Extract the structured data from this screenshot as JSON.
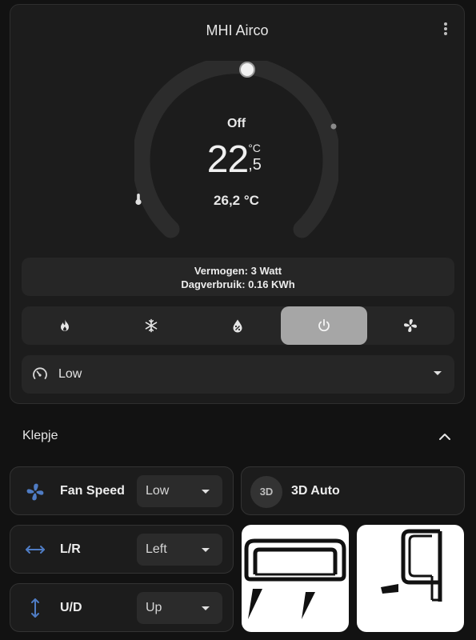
{
  "card": {
    "title": "MHI Airco",
    "state": "Off",
    "target_temp_int": "22",
    "target_temp_dec": ",5",
    "unit": "°C",
    "current_temp": "26,2 °C",
    "info_power": "Vermogen: 3 Watt",
    "info_daily": "Dagverbruik: 0.16 KWh",
    "modes": [
      "heat",
      "cool",
      "dry",
      "off",
      "fan_only"
    ],
    "active_mode": "off",
    "fan_mode": "Low"
  },
  "section": {
    "title": "Klepje"
  },
  "tiles": {
    "fan_speed": {
      "label": "Fan Speed",
      "value": "Low"
    },
    "lr": {
      "label": "L/R",
      "value": "Left"
    },
    "ud": {
      "label": "U/D",
      "value": "Up"
    },
    "auto3d": {
      "label": "3D Auto",
      "badge": "3D"
    }
  },
  "colors": {
    "background": "#121212",
    "card": "#1c1c1c",
    "active_mode": "#a6a6a6",
    "icon_blue": "#4f7cc4"
  }
}
